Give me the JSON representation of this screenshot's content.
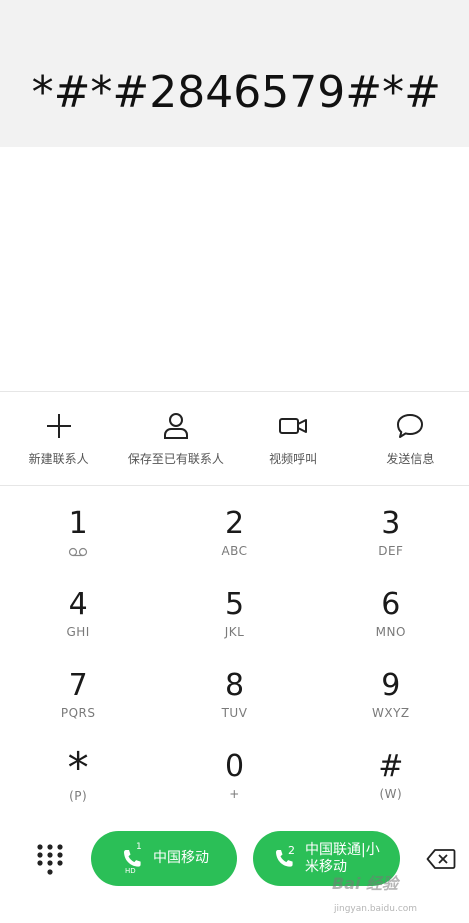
{
  "dialer": {
    "number": "*#*#2846579#*#"
  },
  "actions": [
    {
      "icon": "plus-icon",
      "label": "新建联系人"
    },
    {
      "icon": "person-icon",
      "label": "保存至已有联系人"
    },
    {
      "icon": "video-camera-icon",
      "label": "视频呼叫"
    },
    {
      "icon": "message-bubble-icon",
      "label": "发送信息"
    }
  ],
  "keypad": [
    {
      "digit": "1",
      "letters": ""
    },
    {
      "digit": "2",
      "letters": "ABC"
    },
    {
      "digit": "3",
      "letters": "DEF"
    },
    {
      "digit": "4",
      "letters": "GHI"
    },
    {
      "digit": "5",
      "letters": "JKL"
    },
    {
      "digit": "6",
      "letters": "MNO"
    },
    {
      "digit": "7",
      "letters": "PQRS"
    },
    {
      "digit": "8",
      "letters": "TUV"
    },
    {
      "digit": "9",
      "letters": "WXYZ"
    },
    {
      "digit": "*",
      "letters": "(P)"
    },
    {
      "digit": "0",
      "letters": "+"
    },
    {
      "digit": "#",
      "letters": "(W)"
    }
  ],
  "call_buttons": {
    "sim1": {
      "sim": "1",
      "hd": "HD",
      "label": "中国移动"
    },
    "sim2": {
      "sim": "2",
      "label": "中国联通|小米移动"
    }
  },
  "watermark": {
    "brand": "Bai 经验",
    "url": "jingyan.baidu.com"
  },
  "colors": {
    "call_green": "#2bbf57",
    "number_bg": "#f2f2f2"
  }
}
